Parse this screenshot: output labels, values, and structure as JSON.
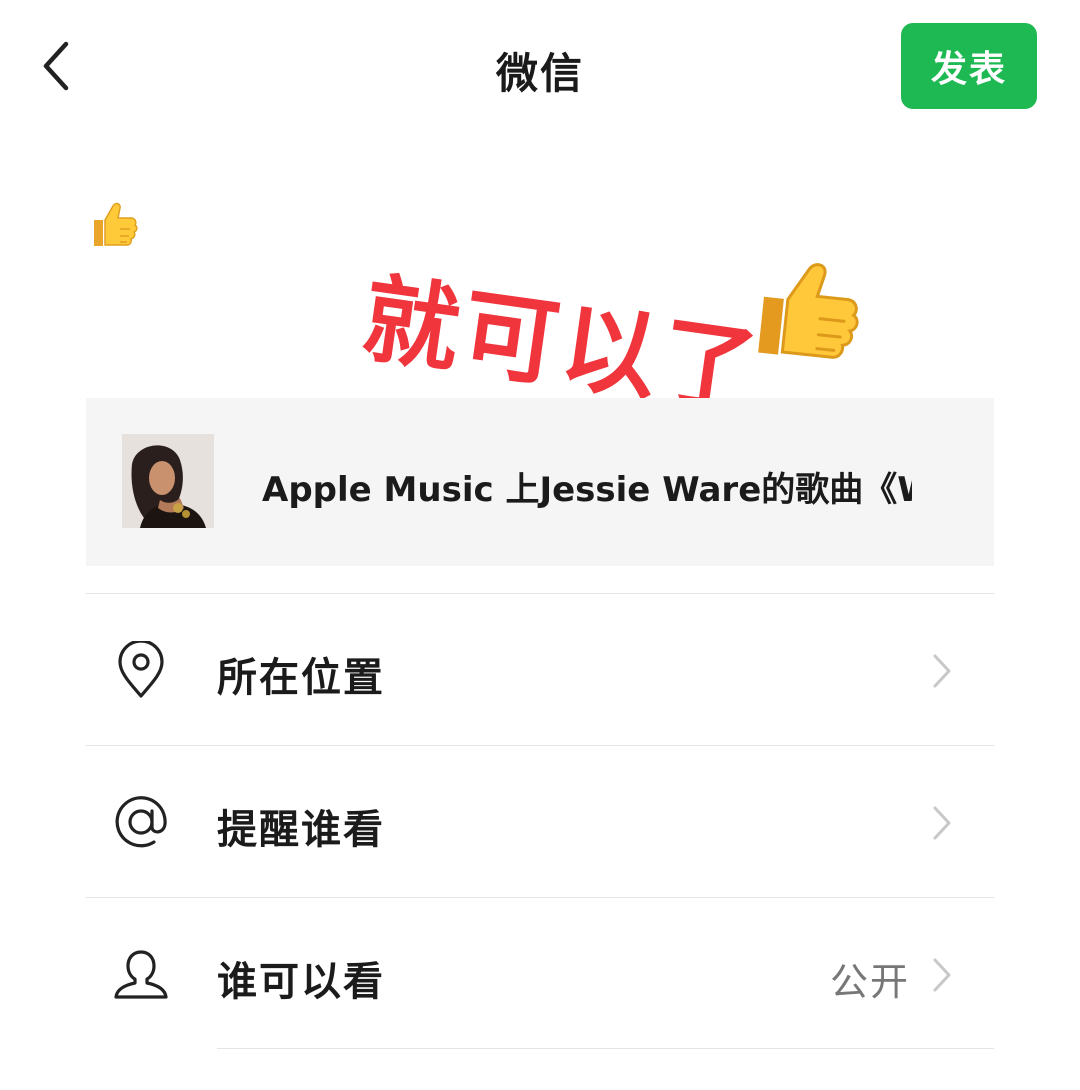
{
  "header": {
    "title": "微信",
    "publish_label": "发表"
  },
  "post": {
    "headline": "就可以了"
  },
  "share_card": {
    "title": "Apple Music 上Jessie Ware的歌曲《W"
  },
  "options": [
    {
      "label": "所在位置",
      "value": "",
      "icon": "location-pin-icon"
    },
    {
      "label": "提醒谁看",
      "value": "",
      "icon": "at-sign-icon"
    },
    {
      "label": "谁可以看",
      "value": "公开",
      "icon": "person-icon"
    }
  ],
  "colors": {
    "accent_green": "#1fb953",
    "headline_red": "#f0353d",
    "card_background": "#f5f5f5"
  }
}
